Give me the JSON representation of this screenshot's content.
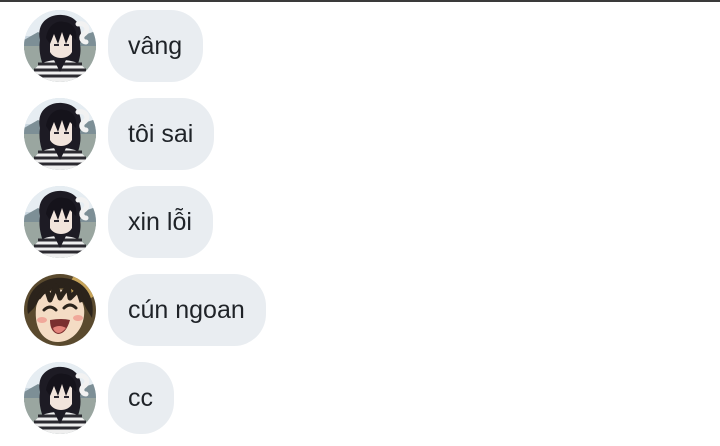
{
  "messages": [
    {
      "text": "vâng",
      "avatar": "dark-haired-character-avatar"
    },
    {
      "text": "tôi sai",
      "avatar": "dark-haired-character-avatar"
    },
    {
      "text": "xin lỗi",
      "avatar": "dark-haired-character-avatar"
    },
    {
      "text": "cún ngoan",
      "avatar": "laughing-boy-avatar"
    },
    {
      "text": "cc",
      "avatar": "dark-haired-character-avatar"
    }
  ],
  "colors": {
    "bubble_background": "#e9edf1",
    "message_text": "#1f2328",
    "top_rule": "#3a3a3a"
  }
}
